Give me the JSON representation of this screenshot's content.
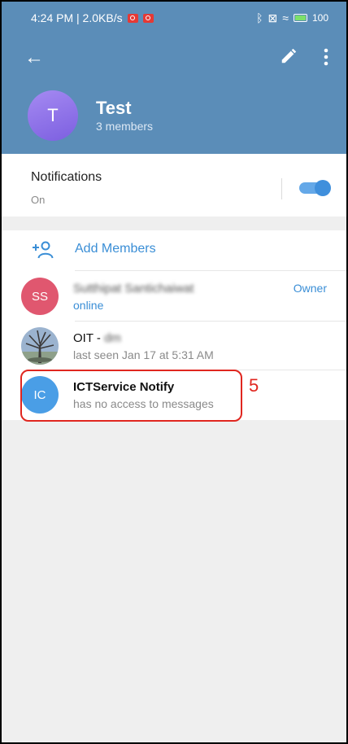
{
  "status_bar": {
    "time_speed": "4:24 PM | 2.0KB/s",
    "battery_pct": "100",
    "icons": [
      "record-icon",
      "record-icon",
      "bluetooth-icon",
      "sim-icon",
      "wifi-icon",
      "battery-icon"
    ]
  },
  "header": {
    "avatar_initial": "T",
    "title": "Test",
    "subtitle": "3 members",
    "color": "#5b8db8"
  },
  "notifications": {
    "title": "Notifications",
    "state": "On",
    "enabled": true
  },
  "add_members_label": "Add Members",
  "members": [
    {
      "initials": "SS",
      "name": "Sutthipat Santichaiwat",
      "status": "online",
      "role": "Owner",
      "color": "#e0576f"
    },
    {
      "initials": "",
      "name": "OIT - ",
      "name_blurred": "dm",
      "status": "last seen Jan 17 at 5:31 AM",
      "color": "#7a9ab8"
    },
    {
      "initials": "IC",
      "name": "ICTService Notify",
      "status": "has no access to messages",
      "color": "#4a9ee6"
    }
  ],
  "annotation": {
    "label": "5",
    "color": "#e0261f"
  }
}
